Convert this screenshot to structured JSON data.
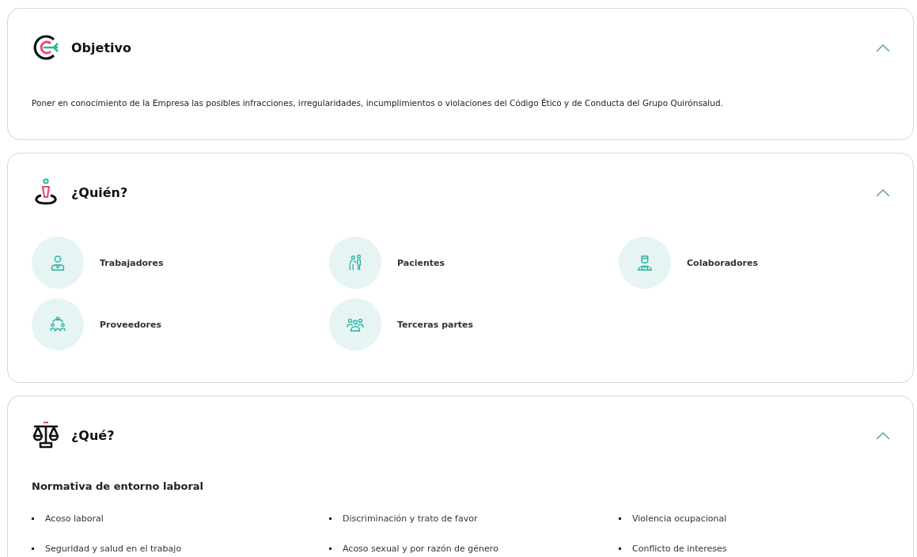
{
  "sections": [
    {
      "kind": "text",
      "title": "Objetivo",
      "expanded": true,
      "text": "Poner en conocimiento de la Empresa las posibles infracciones, irregularidades, incumplimientos o violaciones del Código Ético y de Conducta del Grupo Quirónsalud."
    },
    {
      "kind": "people",
      "title": "¿Quién?",
      "expanded": true,
      "items": [
        {
          "label": "Trabajadores"
        },
        {
          "label": "Pacientes"
        },
        {
          "label": "Colaboradores"
        },
        {
          "label": "Proveedores"
        },
        {
          "label": "Terceras partes"
        }
      ]
    },
    {
      "kind": "list",
      "title": "¿Qué?",
      "expanded": true,
      "subtitle": "Normativa de entorno laboral",
      "items": [
        "Acoso laboral",
        "Discriminación y trato de favor",
        "Violencia ocupacional",
        "Seguridad y salud en el trabajo",
        "Acoso sexual y por razón de género",
        "Conflicto de intereses"
      ]
    }
  ]
}
